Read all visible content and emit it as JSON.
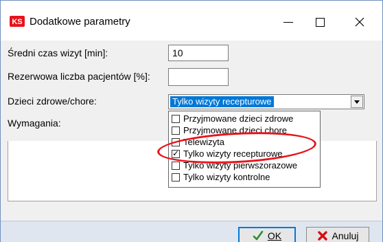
{
  "window": {
    "title": "Dodatkowe parametry",
    "logo_text": "KS"
  },
  "colors": {
    "accent": "#0078d7",
    "highlight_ring": "#e8131a",
    "logo": "#e8131a"
  },
  "form": {
    "visit_time_label": "Średni czas wizyt [min]:",
    "visit_time_value": "10",
    "reserve_label": "Rezerwowa liczba pacjentów [%]:",
    "reserve_value": "",
    "children_label": "Dzieci zdrowe/chore:",
    "children_selected": "Tylko wizyty recepturowe",
    "requirements_label": "Wymagania:"
  },
  "dropdown": {
    "items": [
      {
        "label": "Przyjmowane dzieci zdrowe",
        "checked": false
      },
      {
        "label": "Przyjmowane dzieci chore",
        "checked": false
      },
      {
        "label": "Telewizyta",
        "checked": false
      },
      {
        "label": "Tylko wizyty recepturowe",
        "checked": true
      },
      {
        "label": "Tylko wizyty pierwszorazowe",
        "checked": false
      },
      {
        "label": "Tylko wizyty kontrolne",
        "checked": false
      }
    ]
  },
  "buttons": {
    "ok_label": "OK",
    "cancel_label": "Anuluj"
  }
}
